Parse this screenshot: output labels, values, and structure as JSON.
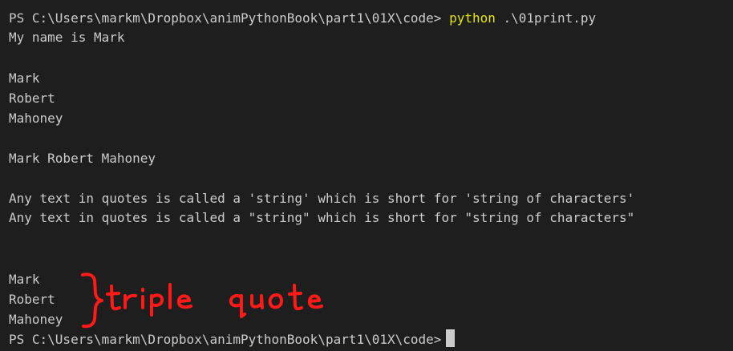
{
  "terminal": {
    "lines": [
      {
        "prompt": "PS C:\\Users\\markm\\Dropbox\\animPythonBook\\part1\\01X\\code>",
        "command": "python",
        "args": ".\\01print.py"
      },
      "My name is Mark",
      "",
      "Mark",
      "Robert",
      "Mahoney",
      "",
      "Mark Robert Mahoney",
      "",
      "Any text in quotes is called a 'string' which is short for 'string of characters'",
      "Any text in quotes is called a \"string\" which is short for \"string of characters\"",
      "",
      "",
      "Mark",
      "Robert",
      "Mahoney"
    ],
    "final_prompt": "PS C:\\Users\\markm\\Dropbox\\animPythonBook\\part1\\01X\\code>"
  },
  "annotation": {
    "text": "triple quote",
    "color": "#ff1a1a"
  },
  "colors": {
    "background": "#1e1e1e",
    "text": "#cccccc",
    "command": "#e5e510"
  }
}
